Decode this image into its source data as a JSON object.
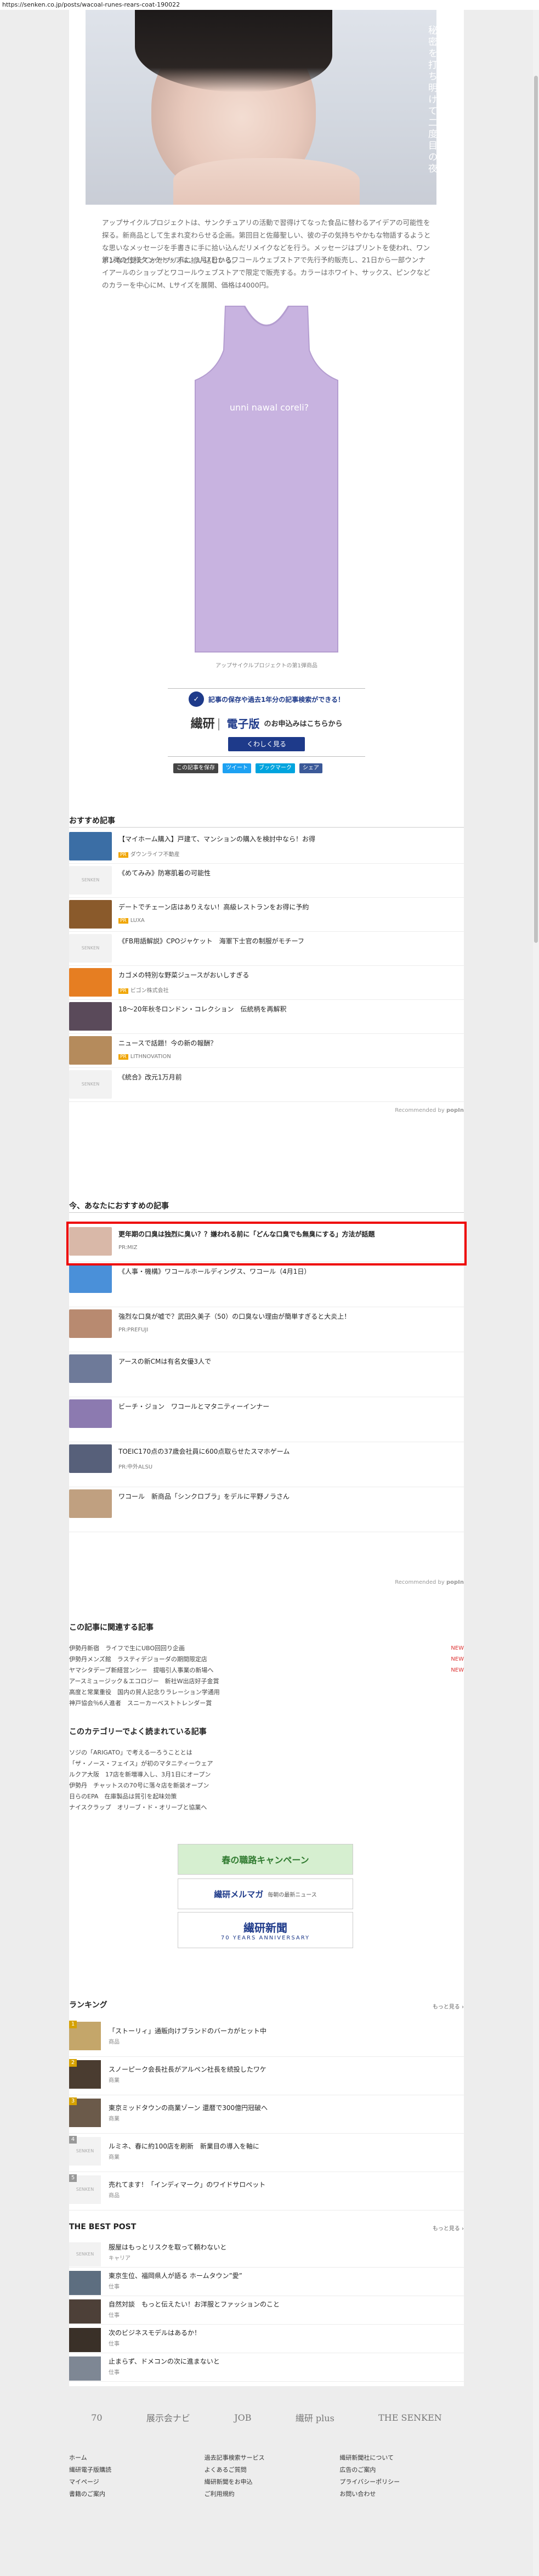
{
  "url_bar": "https://senken.co.jp/posts/wacoal-runes-rears-coat-190022",
  "hero": {
    "caption": "秘密を打ち明けて二度目の夜"
  },
  "article": {
    "para1": "アップサイクルプロジェクトは、サンクチュアリの活動で習得けてなった食品に替わるアイデアの可能性を探る。新商品として生まれ変わらせる企画。第回目と佐藤聖しい、彼の子の気持ちやかもな物語するようとな思いなメッセージを手書きに手に拾い込んだリメイクなどを行う。メッセージはプリントを使われ、ワンポンなど受えてかせプリ手に拾い込むいる。",
    "para2": "第1弾の仕様タンクトップは、1月7日からワコールウェブストアで先行予約販売し、21日から一部ウンナイアールのショップとワコールウェブストアで限定で販売する。カラーはホワイト、サックス、ピンクなどのカラーを中心にM、Lサイズを展開、価格は4000円。",
    "tank_text": "unni nawal coreli?",
    "tank_caption": "アップサイクルプロジェクトの第1弾商品"
  },
  "banner": {
    "emblem": "✓",
    "message": "記事の保存や過去1年分の記事検索ができる！",
    "logo_left": "繊研",
    "logo_right": "電子版",
    "apply": "のお申込みはこちらから",
    "button": "くわしく見る"
  },
  "share": {
    "count": "この記事を保存",
    "tweet": "ツイート",
    "hatena": "ブックマーク",
    "fb": "シェア"
  },
  "recommend": {
    "title": "おすすめ記事",
    "items": [
      {
        "title": "【マイホーム購入】戸建て、マンションの購入を検討中なら！お得",
        "sponsor": "ダウンライフ不動産",
        "pr": "PR",
        "thumb": "#3b6ea5"
      },
      {
        "title": "《めてみみ》防寒肌着の可能性",
        "sponsor": "",
        "pr": "",
        "thumb": "none"
      },
      {
        "title": "デートでチェーン店はありえない！高級レストランをお得に予約",
        "sponsor": "LUXA",
        "pr": "PR",
        "thumb": "#8a5a2b"
      },
      {
        "title": "《FB用語解説》CPOジャケット　海軍下士官の制服がモチーフ",
        "sponsor": "",
        "pr": "",
        "thumb": "none"
      },
      {
        "title": "カゴメの特別な野菜ジュースがおいしすぎる",
        "sponsor": "ビゴン株式会社",
        "pr": "PR",
        "thumb": "#e67e22"
      },
      {
        "title": "18～20年秋冬ロンドン・コレクション　伝統柄を再解釈",
        "sponsor": "",
        "pr": "",
        "thumb": "#5a4a5a"
      },
      {
        "title": "ニュースで話題！今の新の報酬？",
        "sponsor": "LITHNOVATION",
        "pr": "PR",
        "thumb": "#b58b5c"
      },
      {
        "title": "《統合》改元1万月前",
        "sponsor": "",
        "pr": "",
        "thumb": "none"
      }
    ],
    "recommended_by": "Recommended by",
    "brand": "popIn"
  },
  "other": {
    "title": "今、あなたにおすすめの記事",
    "items": [
      {
        "title": "更年期の口臭は独烈に臭い？？嫌われる前に「どんな口臭でも無臭にする」方法が話題",
        "sponsor": "PR:MIZ",
        "thumb": "#d9b8a8"
      },
      {
        "title": "《人事・機構》ワコールホールディングス、ワコール（4月1日）",
        "sponsor": "",
        "thumb": "#4a90d9"
      },
      {
        "title": "強烈な口臭が嘘で？武田久美子（50）の口臭ない理由が簡単すぎると大炎上！",
        "sponsor": "PR:PREFUJI",
        "thumb": "#b88a70"
      },
      {
        "title": "アースの新CMは有名女優3人で",
        "sponsor": "",
        "thumb": "#6e7a99"
      },
      {
        "title": "ビーチ・ジョン　ワコールとマタニティーインナー",
        "sponsor": "",
        "thumb": "#8c7ab0"
      },
      {
        "title": "TOEIC170点の37歳会社員に600点取らせたスマホゲーム",
        "sponsor": "PR:中外ALSU",
        "thumb": "#57607a"
      },
      {
        "title": "ワコール　新商品「シンクロブラ」をデルに平野ノラさん",
        "sponsor": "",
        "thumb": "#c0a080"
      }
    ],
    "recommended_by": "Recommended by",
    "brand": "popIn"
  },
  "related": {
    "title": "この記事に関連する記事",
    "items": [
      {
        "text": "伊勢丹新宿　ライフで生にUBO回回り企画",
        "badge": "NEW"
      },
      {
        "text": "伊勢丹メンズ館　ラスティデジョーダの期間限定店",
        "badge": "NEW"
      },
      {
        "text": "ヤマシタデーブ新経営ンシー　提唱引人事業の新場へ",
        "badge": "NEW"
      },
      {
        "text": "アースミュージック＆エコロジー　新社W出店好子金賞",
        "badge": ""
      },
      {
        "text": "高度と常業重役　国内の貿人記念りラレーション学通用",
        "badge": ""
      },
      {
        "text": "神戸協会％6人進者　スニーカーベストトレンダー賞",
        "badge": ""
      }
    ]
  },
  "category": {
    "title": "このカテゴリーでよく読まれている記事",
    "items": [
      "ソジの「ARIGATO」で考える一ろうこととは",
      "「ザ・ノース・フェイス」が初のマタニティーウェア",
      "ルクア大阪　17店を新増導入し、3月1日にオープン",
      "伊勢丹　チャットスの70号に落々店を新装オープン",
      "日らのEPA　在庫製品は質引を起味効策",
      "ナイスクラップ　オリーブ・ド・オリーブと協業へ"
    ]
  },
  "center_banners": {
    "camp": "春の職路キャンペーン",
    "mail": "繊研メルマガ",
    "mail_sub": "毎朝の最新ニュース",
    "seventy_logo": "繊研新聞",
    "seventy_sub": "70 YEARS ANNIVERSARY"
  },
  "ranking": {
    "title": "ランキング",
    "more": "もっと見る ›",
    "items": [
      {
        "num": "1",
        "title": "「ストーリィ」通販向けブランドのバーカがヒット中",
        "cat": "商品",
        "thumb": "#c4a66a"
      },
      {
        "num": "2",
        "title": "スノーピーク会長社長がアルペン社長を続投したワケ",
        "cat": "商業",
        "thumb": "#4a3c30"
      },
      {
        "num": "3",
        "title": "東京ミッドタウンの商業ゾーン 還暦で300億円冠破へ",
        "cat": "商業",
        "thumb": "#6b5a4a"
      },
      {
        "num": "4",
        "title": "ルミネ、春に約100店を刷新　新業目の導入を軸に",
        "cat": "商業",
        "thumb": "none"
      },
      {
        "num": "5",
        "title": "売れてます！「インディマーク」のワイドサロペット",
        "cat": "商品",
        "thumb": "none"
      }
    ]
  },
  "best_post": {
    "title": "THE BEST POST",
    "more": "もっと見る ›",
    "items": [
      {
        "title": "服屋はもっとリスクを取って頼わないと",
        "cat": "キャリア",
        "thumb": "none"
      },
      {
        "title": "東京生位、福岡県人が語る ホームタウン”愛”",
        "cat": "仕事",
        "thumb": "#5d6e80"
      },
      {
        "title": "自然対談　もっと伝えたい！お洋服とファッションのこと",
        "cat": "仕事",
        "thumb": "#4d4038"
      },
      {
        "title": "次のビジネスモデルはあるか！",
        "cat": "仕事",
        "thumb": "#3a3028"
      },
      {
        "title": "止まらず、ドメコンの次に進まないと",
        "cat": "仕事",
        "thumb": "#7e8794"
      }
    ]
  },
  "footer": {
    "logos": [
      "70",
      "展示会ナビ",
      "JOB",
      "繊研 plus",
      "THE SENKEN"
    ],
    "links": [
      [
        "ホーム",
        "繊研電子版購読",
        "マイページ",
        "書籍のご案内"
      ],
      [
        "過去記事検索サービス",
        "よくあるご質問",
        "繊研新聞をお申込",
        "ご利用規約"
      ],
      [
        "繊研新聞社について",
        "広告のご案内",
        "プライバシーポリシー",
        "お問い合わせ"
      ]
    ]
  }
}
